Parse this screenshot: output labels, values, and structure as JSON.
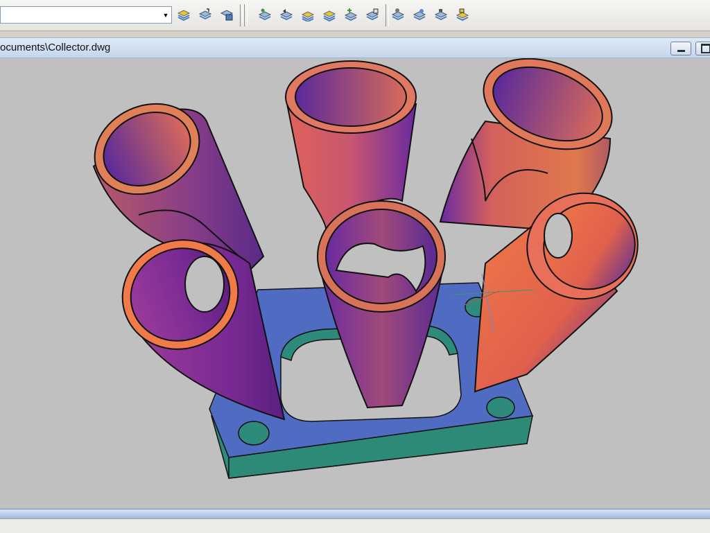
{
  "toolbar": {
    "layer_combo_value": "",
    "icons": [
      "layer-states-icon",
      "layer-previous-icon",
      "layer-properties-icon",
      "layer-match-icon",
      "layer-isolate-icon",
      "layer-unisolate-icon",
      "layer-walk-icon",
      "layer-merge-icon",
      "layer-delete-icon",
      "layer-off-icon",
      "layer-freeze-icon",
      "layer-lock-icon",
      "layer-unlock-icon",
      "layer-current-icon"
    ]
  },
  "document": {
    "title": "ocuments\\Collector.dwg",
    "minimize_label": "minimize",
    "restore_label": "restore"
  },
  "viewport": {
    "model": "exhaust collector",
    "background_color": "#c0c0c0",
    "flange_color": "#4f6bc2",
    "flange_side_color": "#2e8a7a",
    "tube_gradient": [
      "#6a2a9a",
      "#d45a6a",
      "#f07848"
    ]
  }
}
